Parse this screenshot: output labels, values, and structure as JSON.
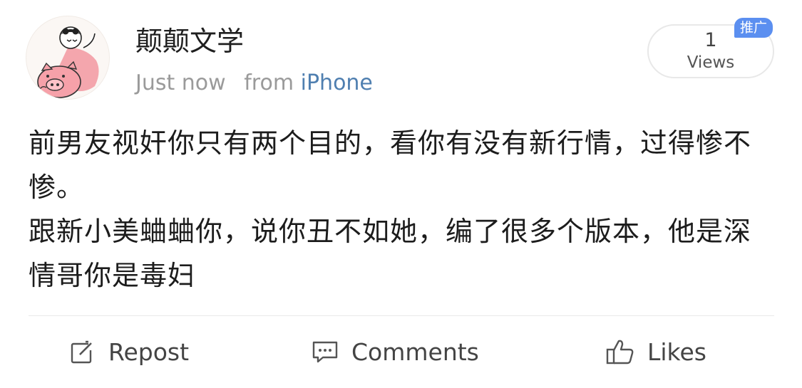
{
  "header": {
    "username": "颠颠文学",
    "time": "Just now",
    "from_label": "from",
    "device": "iPhone",
    "views_count": "1",
    "views_label": "Views",
    "promo_badge": "推广"
  },
  "post": {
    "paragraphs": [
      "前男友视奸你只有两个目的，看你有没有新行情，过得惨不惨。",
      "跟新小美蛐蛐你，说你丑不如她，编了很多个版本，他是深情哥你是毒妇"
    ]
  },
  "actions": {
    "repost": "Repost",
    "comments": "Comments",
    "likes": "Likes"
  },
  "icons": {
    "repost": "repost-icon",
    "comments": "comment-icon",
    "likes": "thumbs-up-icon"
  },
  "colors": {
    "link": "#4f7fb0",
    "badge": "#5b8ff0",
    "meta_gray": "#9a9a9a"
  }
}
